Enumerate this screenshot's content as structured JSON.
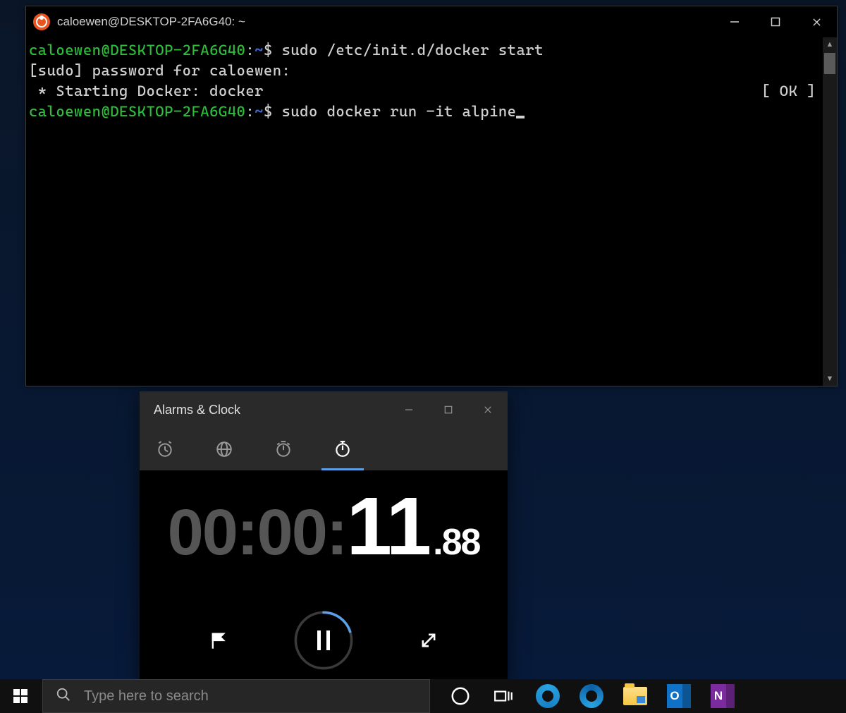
{
  "terminal": {
    "title": "caloewen@DESKTOP-2FA6G40: ~",
    "prompt1": {
      "user": "caloewen",
      "at": "@",
      "host": "DESKTOP-2FA6G40",
      "colon": ":",
      "path": "~",
      "dollar": "$ "
    },
    "cmd1": "sudo /etc/init.d/docker start",
    "line2": "[sudo] password for caloewen:",
    "line3_left": " * Starting Docker: docker",
    "line3_right": "[ OK ]",
    "cmd2": "sudo docker run -it alpine"
  },
  "clock": {
    "title": "Alarms & Clock",
    "tabs": [
      "alarm",
      "world-clock",
      "timer",
      "stopwatch"
    ],
    "active_tab": "stopwatch",
    "hm": "00:00:",
    "sec": "11",
    "frac": ".88",
    "progress_deg": 72
  },
  "taskbar": {
    "search_placeholder": "Type here to search"
  }
}
